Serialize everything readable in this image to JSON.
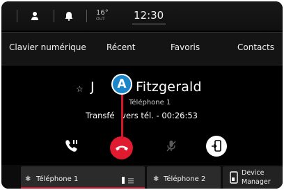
{
  "status_bar": {
    "icons": [
      "person-icon",
      "bell-icon"
    ],
    "temperature": "16°",
    "temperature_unit": "OUT",
    "time": "12:30"
  },
  "tabs": [
    {
      "label": "Clavier numérique"
    },
    {
      "label": "Récent"
    },
    {
      "label": "Favoris"
    },
    {
      "label": "Contacts"
    }
  ],
  "call": {
    "contact_name_start": "J",
    "contact_name_end": "Fitzgerald",
    "phone_label": "Téléphone 1",
    "status_start": "Transfé",
    "status_end": "vers tél. - 00:26:53",
    "marker": "A"
  },
  "controls": {
    "icons": [
      "keypad-phone-icon",
      "hang-up-icon",
      "mute-microphone-icon",
      "transfer-call-icon"
    ],
    "hangup_color": "#e01b2f"
  },
  "devices": [
    {
      "label": "Téléphone 1",
      "active": true
    },
    {
      "label": "Téléphone 2",
      "active": false
    }
  ],
  "device_manager": {
    "line1": "Device",
    "line2": "Manager"
  },
  "colors": {
    "accent_red": "#d9142a",
    "marker_blue": "#1a85c8"
  }
}
